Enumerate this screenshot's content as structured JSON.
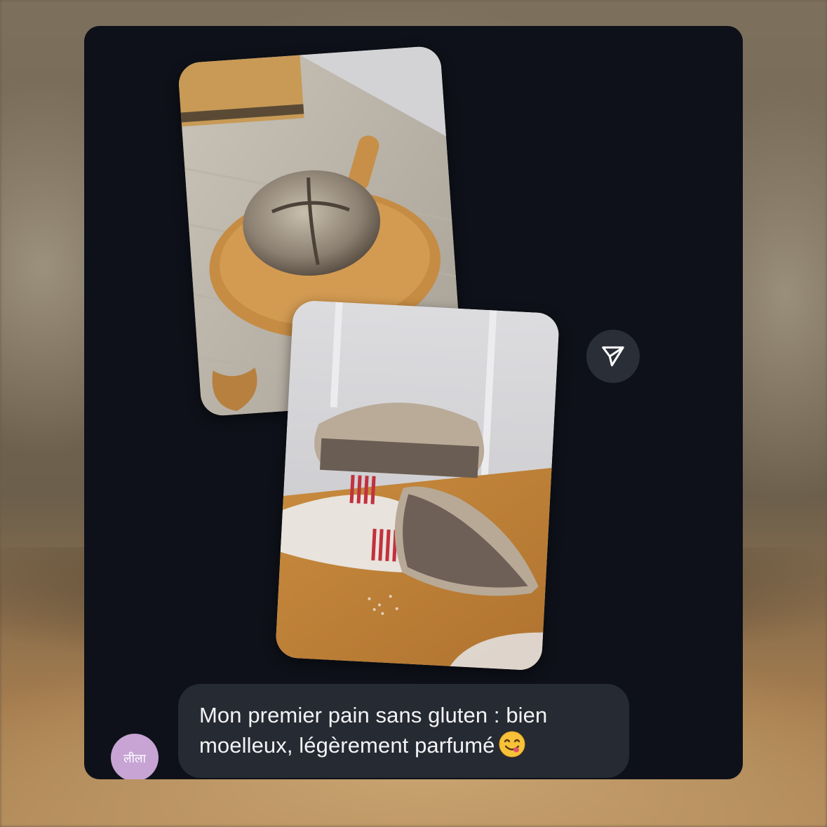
{
  "background": {
    "description_colors": [
      "#a59a86",
      "#6c5f4c",
      "#b48c5c"
    ]
  },
  "panel": {
    "background": "#0e1119"
  },
  "photos": [
    {
      "name": "bread-loaf-on-board-photo"
    },
    {
      "name": "bread-loaf-sliced-photo"
    }
  ],
  "share_button": {
    "icon": "paper-plane-icon"
  },
  "message": {
    "sender_avatar_text": "लीला",
    "avatar_color": "#c7a4d4",
    "text": "Mon premier pain sans gluten : bien moelleux, légèrement parfumé",
    "emoji": "yum-face-emoji"
  }
}
